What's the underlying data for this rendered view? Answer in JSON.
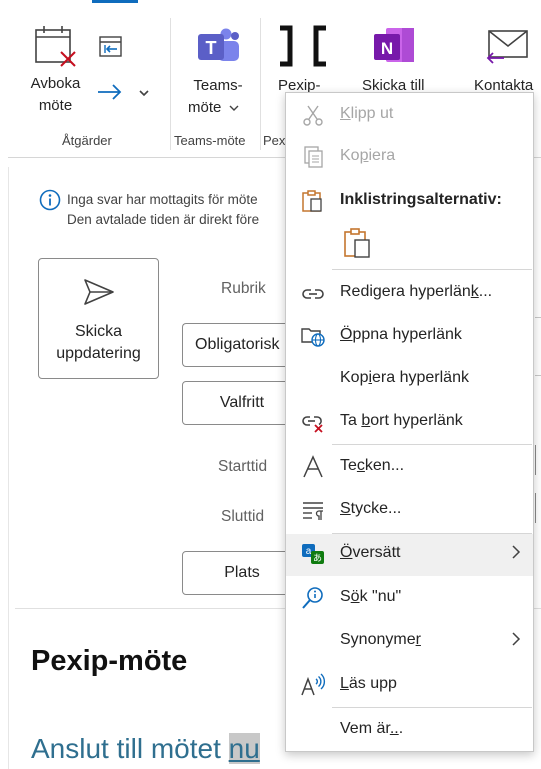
{
  "ribbon": {
    "groups": {
      "actions": {
        "label": "Åtgärder",
        "cancel_meeting_line1": "Avboka",
        "cancel_meeting_line2": "möte"
      },
      "teams": {
        "label": "Teams-möte",
        "button_line1": "Teams-",
        "button_line2": "möte"
      },
      "pexip": {
        "label": "Pex",
        "button_line1": "Pexip-"
      },
      "onenote": {
        "button_line1": "Skicka till"
      },
      "contacts": {
        "button_line1": "Kontakta"
      }
    }
  },
  "info": {
    "line1": "Inga svar har mottagits för möte",
    "line2": "Den avtalade tiden är direkt före"
  },
  "send_update": {
    "line1": "Skicka",
    "line2": "uppdatering"
  },
  "fields": {
    "subject_label": "Rubrik",
    "required_label": "Obligatorisk",
    "optional_label": "Valfritt",
    "start_label": "Starttid",
    "end_label": "Sluttid",
    "location_label": "Plats"
  },
  "body": {
    "heading": "Pexip-möte",
    "link_text": "Anslut till mötet",
    "selected_word": "nu"
  },
  "context_menu": {
    "cut": {
      "pre": "",
      "acc": "K",
      "post": "lipp ut"
    },
    "copy": {
      "pre": "Ko",
      "acc": "p",
      "post": "iera"
    },
    "paste_options_title": "Inklistringsalternativ:",
    "edit_link": {
      "pre": "Redigera hyperlän",
      "acc": "k",
      "post": "..."
    },
    "open_link": {
      "pre": "",
      "acc": "Ö",
      "post": "ppna hyperlänk"
    },
    "copy_link": {
      "pre": "Kop",
      "acc": "i",
      "post": "era hyperlänk"
    },
    "remove_link": {
      "pre": "Ta ",
      "acc": "b",
      "post": "ort hyperlänk"
    },
    "font": {
      "pre": "Te",
      "acc": "c",
      "post": "ken..."
    },
    "paragraph": {
      "pre": "",
      "acc": "S",
      "post": "tycke..."
    },
    "translate": {
      "pre": "",
      "acc": "Ö",
      "post": "versätt"
    },
    "search": {
      "pre": "S",
      "acc": "ö",
      "post": "k \"nu\""
    },
    "synonyms": {
      "pre": "Synonyme",
      "acc": "r",
      "post": ""
    },
    "read_aloud": {
      "pre": "",
      "acc": "L",
      "post": "äs upp"
    },
    "who_is": {
      "pre": "Vem är",
      "acc": "..",
      "post": "."
    }
  },
  "colors": {
    "accent_blue": "#0f6cbd",
    "teams_purple": "#5b5fc7",
    "onenote_purple": "#7719aa",
    "delete_red": "#c50f1f",
    "paste_orange": "#c4762f",
    "link_teal": "#2f6f8f"
  }
}
